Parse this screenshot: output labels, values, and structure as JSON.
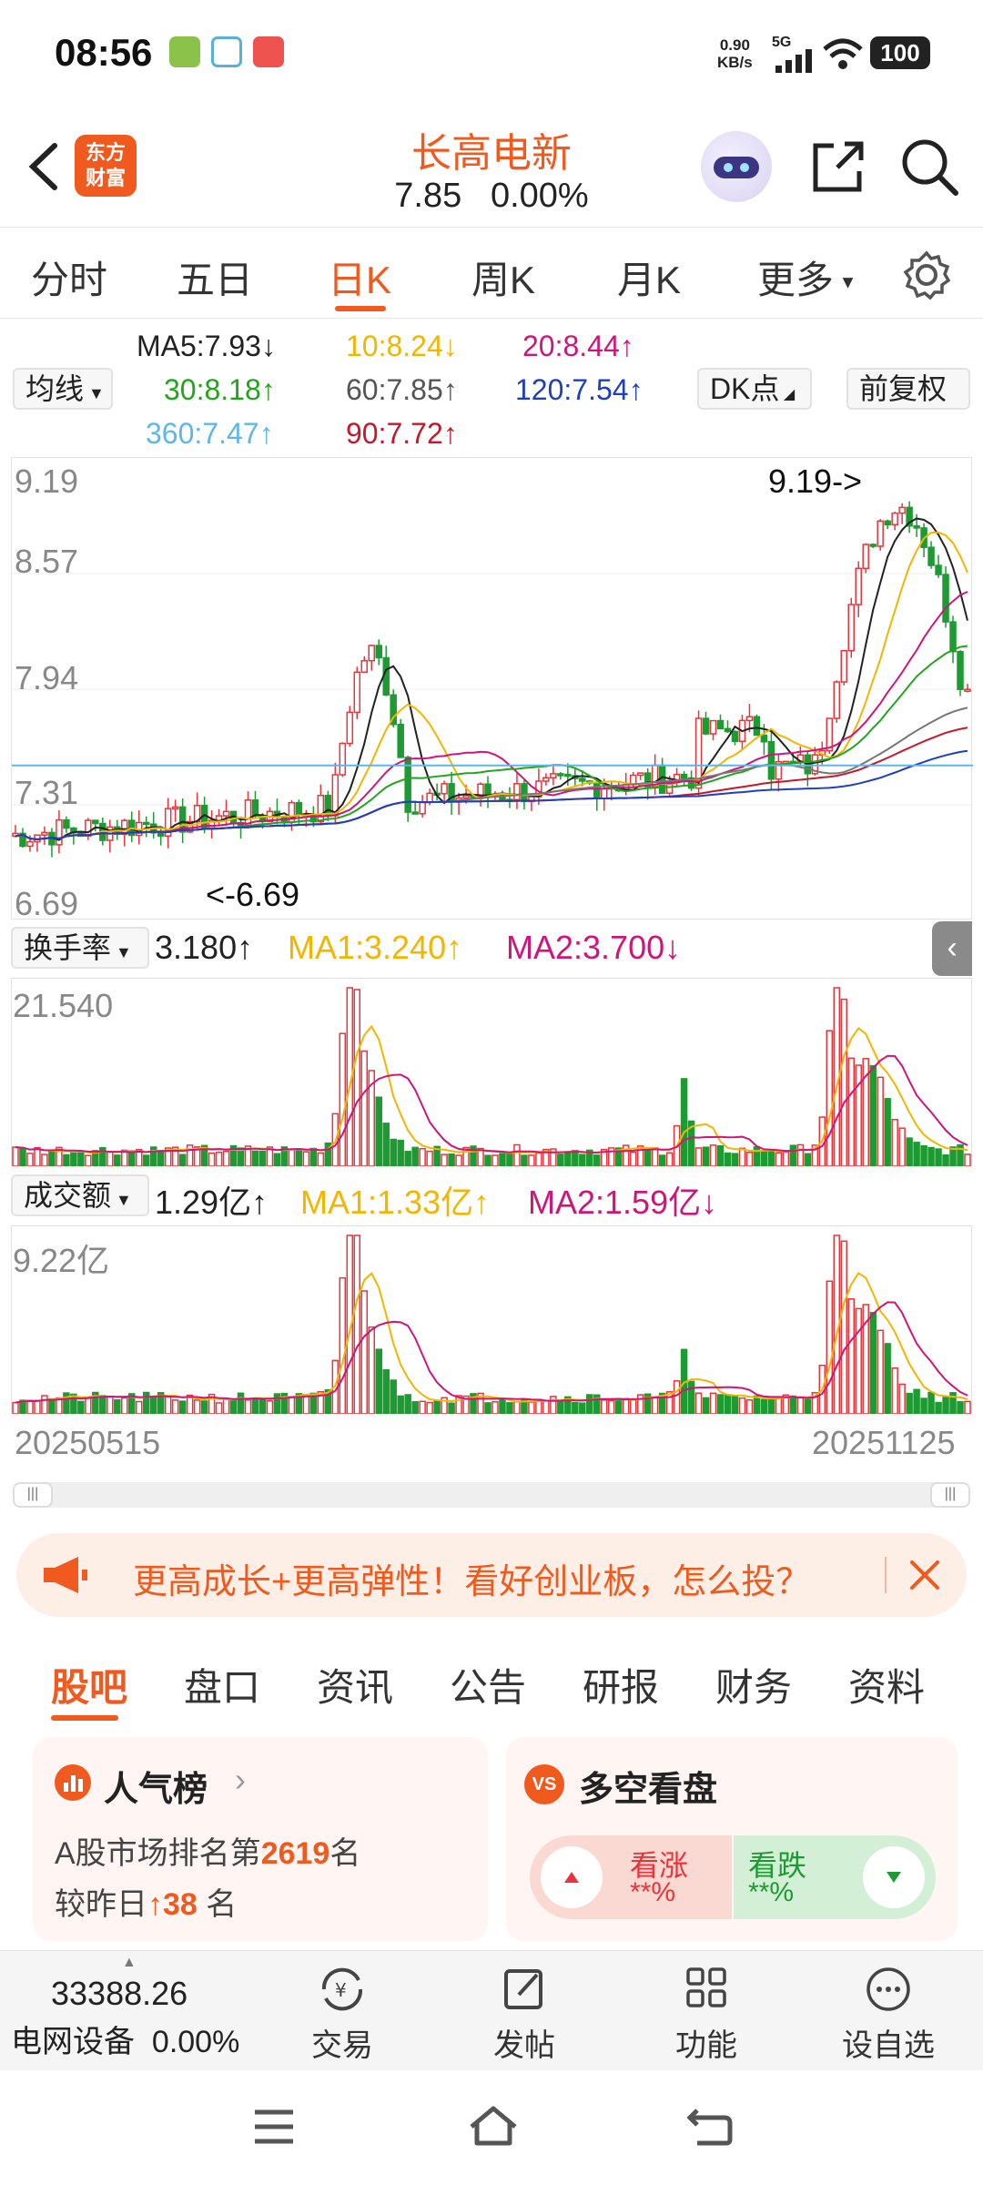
{
  "status_bar": {
    "time": "08:56",
    "net_speed": "0.90",
    "net_unit": "KB/s",
    "signal": "5G",
    "battery": "100"
  },
  "header": {
    "logo_line1": "东方",
    "logo_line2": "财富",
    "stock_name": "长高电新",
    "price": "7.85",
    "change": "0.00%"
  },
  "period_tabs": [
    "分时",
    "五日",
    "日K",
    "周K",
    "月K",
    "更多"
  ],
  "active_period": "日K",
  "ma_legend": {
    "selector": "均线",
    "ma5": "MA5:7.93↓",
    "ma10": "10:8.24↓",
    "ma20": "20:8.44↑",
    "ma30": "30:8.18↑",
    "ma60": "60:7.85↑",
    "ma120": "120:7.54↑",
    "ma360": "360:7.47↑",
    "ma90": "90:7.72↑",
    "dk_button": "DK点",
    "adjust_button": "前复权"
  },
  "colors": {
    "accent": "#f05a1e",
    "up": "#e8343b",
    "down": "#1e9a33",
    "ma5": "#222222",
    "ma10": "#f2b600",
    "ma20": "#d0157a",
    "ma30": "#21a51d",
    "ma60": "#777777",
    "ma120": "#1f3fbf",
    "ma360": "#5db7e8",
    "ma90": "#c21a2c"
  },
  "kline": {
    "y_labels": [
      "9.19",
      "8.57",
      "7.94",
      "7.31",
      "6.69"
    ],
    "high_note": "9.19->",
    "low_note": "<-6.69"
  },
  "turnover": {
    "selector": "换手率",
    "value": "3.180↑",
    "ma1": "MA1:3.240↑",
    "ma2": "MA2:3.700↓",
    "y_top": "21.540"
  },
  "volume": {
    "selector": "成交额",
    "value": "1.29亿↑",
    "ma1": "MA1:1.33亿↑",
    "ma2": "MA2:1.59亿↓",
    "y_top": "9.22亿"
  },
  "date_range": {
    "start": "20250515",
    "end": "20251125"
  },
  "banner": {
    "text": "更高成长+更高弹性！看好创业板，怎么投？"
  },
  "community_tabs": [
    "股吧",
    "盘口",
    "资讯",
    "公告",
    "研报",
    "财务",
    "资料"
  ],
  "active_community_tab": "股吧",
  "popularity_card": {
    "title": "人气榜",
    "line1_prefix": "A股市场排名第",
    "rank": "2619",
    "line1_suffix": "名",
    "line2_prefix": "较昨日",
    "change": "38",
    "line2_suffix": "名"
  },
  "sentiment_card": {
    "title": "多空看盘",
    "bull_label": "看涨",
    "bull_value": "**%",
    "bear_label": "看跌",
    "bear_value": "**%"
  },
  "toolbar": {
    "index_value": "33388.26",
    "index_name": "电网设备",
    "index_change": "0.00%",
    "items": [
      "交易",
      "发帖",
      "功能",
      "设自选"
    ]
  }
}
